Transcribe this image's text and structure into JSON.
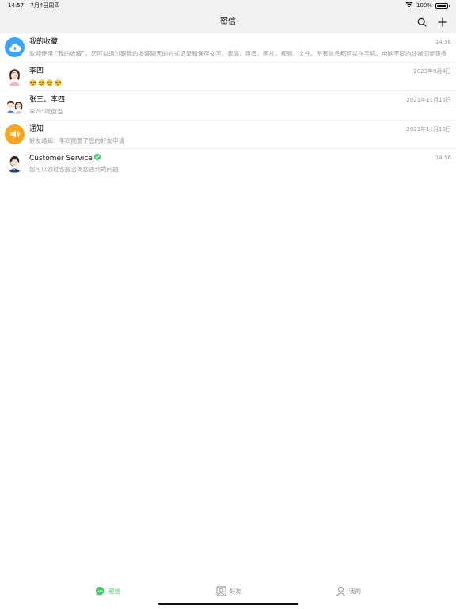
{
  "status_bar": {
    "time": "14:57",
    "date": "7月4日周四",
    "battery": "100%"
  },
  "nav": {
    "title": "密信",
    "search_icon": "search-icon",
    "add_icon": "plus-icon"
  },
  "conversations": [
    {
      "name": "我的收藏",
      "time": "14:56",
      "preview": "欢迎使用 “我的收藏”，您可以通过跟我的收藏聊天的方式记录和保存文字、表情、声音、图片、视频、文件。所有信息都可以在手机、电脑不同的终端同步查看",
      "avatar": "cloud-upload-icon"
    },
    {
      "name": "李四",
      "time": "2023年9月4日",
      "preview": "",
      "avatar": "girl-avatar"
    },
    {
      "name": "张三、李四",
      "time": "2021年11月16日",
      "preview": "李四: 吃便当",
      "avatar": "group-avatar"
    },
    {
      "name": "通知",
      "time": "2021年11月16日",
      "preview": "好友通知：李四同意了您的好友申请",
      "avatar": "speaker-icon"
    },
    {
      "name": "Customer Service",
      "time": "14:56",
      "preview": "您可以通过客服咨询您遇到的问题",
      "avatar": "service-agent-avatar"
    }
  ],
  "tabs": [
    {
      "label": "密信",
      "icon": "chat-bubble-icon",
      "active": true
    },
    {
      "label": "好友",
      "icon": "contacts-icon",
      "active": false
    },
    {
      "label": "我的",
      "icon": "person-icon",
      "active": false
    }
  ],
  "colors": {
    "accent": "#4cc66c",
    "favorites_avatar": "#3aa3f5",
    "notice_avatar": "#f5a623",
    "secondary_text": "#9a9a9a"
  }
}
